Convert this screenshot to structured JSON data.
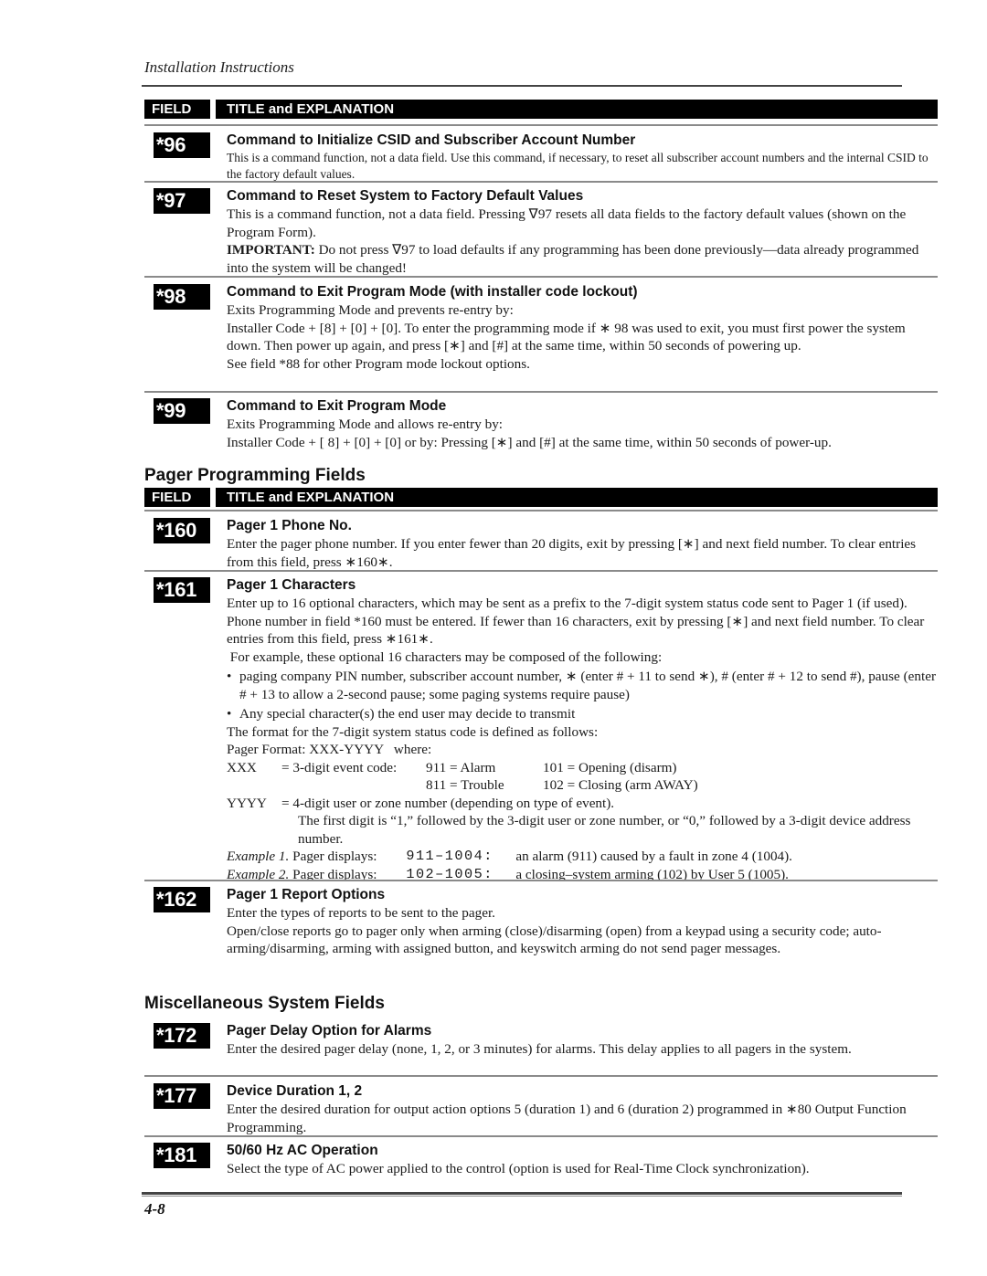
{
  "running_head": "Installation Instructions",
  "table_header": {
    "field": "FIELD",
    "title": "TITLE and EXPLANATION"
  },
  "entries_top": [
    {
      "field": "*96",
      "title": "Command to Initialize CSID and Subscriber Account Number",
      "lines": [
        "This is a command function, not a data field. Use this command, if necessary, to reset all subscriber account numbers and the internal CSID to the factory default values."
      ]
    },
    {
      "field": "*97",
      "title": "Command to Reset System to Factory Default Values",
      "lines": [
        "This is a command function, not a data field. Pressing ∇97 resets all data fields to the factory default values (shown on the Program Form)."
      ],
      "important_label": "IMPORTANT:",
      "important_text": " Do not press ∇97 to load defaults if any programming has been done previously—data already programmed into the system will be changed!"
    },
    {
      "field": "*98",
      "title": "Command to Exit Program Mode (with installer code lockout)",
      "lines": [
        "Exits Programming Mode and prevents re-entry by:",
        "Installer Code + [8] + [0] + [0]. To enter the programming mode if ∗ 98 was used to exit, you must first power the system down. Then power up again, and press [∗] and [#] at the same time, within 50 seconds of powering up.",
        "See field *88 for other Program mode lockout options."
      ]
    },
    {
      "field": "*99",
      "title": "Command to Exit Program Mode",
      "lines": [
        "Exits Programming Mode and allows re-entry by:",
        "Installer Code + [ 8] + [0] + [0] or by: Pressing [∗] and [#] at the same time, within 50 seconds of power-up."
      ]
    }
  ],
  "sections": {
    "pager": "Pager Programming Fields",
    "misc": "Miscellaneous System Fields"
  },
  "pager_entries": {
    "e160": {
      "field": "*160",
      "title": "Pager 1 Phone No.",
      "text": "Enter the pager phone number. If you enter fewer than 20 digits, exit by pressing [∗] and next field number. To clear entries from this field, press ∗160∗."
    },
    "e161": {
      "field": "*161",
      "title": "Pager 1 Characters",
      "text": "Enter up to 16 optional characters, which may be sent as a prefix to the 7-digit system status code sent to Pager 1 (if used). Phone number in field *160 must be entered. If fewer than 16 characters, exit by pressing [∗] and next field number. To clear entries from this field, press ∗161∗.",
      "example_intro": " For example, these optional 16 characters may be composed of the following:",
      "bullets": [
        "paging company PIN number, subscriber account number, ∗ (enter # + 11 to send ∗), # (enter # + 12 to send #), pause (enter # + 13 to allow a 2-second pause; some paging systems require pause)",
        "Any special character(s) the end user may decide to transmit"
      ],
      "format_intro": "The format for the 7-digit system status code is defined as follows:",
      "pager_format": "Pager Format: XXX-YYYY   where:",
      "xxx_label": "XXX",
      "xxx_def": "= 3-digit event code:",
      "codes": [
        {
          "a": "911 = Alarm",
          "b": "101 = Opening (disarm)"
        },
        {
          "a": "811 = Trouble",
          "b": "102 = Closing (arm AWAY)"
        }
      ],
      "yyyy_label": "YYYY",
      "yyyy_def": "= 4-digit user or zone number (depending on type of event).",
      "yyyy_note": "The first digit is “1,” followed by the 3-digit user or zone number, or “0,” followed by a 3-digit device address number.",
      "examples": [
        {
          "label": "Example 1.",
          "prefix": " Pager displays:",
          "code": "911–1004:",
          "desc": "an alarm (911) caused by a fault in zone 4 (1004)."
        },
        {
          "label": "Example 2.",
          "prefix": " Pager displays:",
          "code": "102–1005:",
          "desc": "a closing–system arming (102) by User 5 (1005)."
        }
      ]
    },
    "e162": {
      "field": "*162",
      "title": "Pager 1 Report Options",
      "lines": [
        "Enter the types of reports to be sent to the pager.",
        "Open/close reports go to pager only when arming (close)/disarming (open) from a keypad using a security code; auto-arming/disarming, arming with assigned button, and keyswitch arming do not send pager messages."
      ]
    }
  },
  "misc_entries": {
    "e172": {
      "field": "*172",
      "title": "Pager Delay Option for Alarms",
      "text": "Enter the desired pager delay (none, 1, 2, or 3 minutes) for alarms.  This delay applies to all pagers in the system."
    },
    "e177": {
      "field": "*177",
      "title": "Device Duration 1, 2",
      "text": "Enter the desired duration for output action options 5 (duration 1) and 6 (duration 2) programmed in ∗80 Output Function Programming."
    },
    "e181": {
      "field": "*181",
      "title": "50/60 Hz AC Operation",
      "text": "Select the type of AC power applied to the control (option is used for Real-Time Clock synchronization)."
    }
  },
  "page_number": "4-8"
}
